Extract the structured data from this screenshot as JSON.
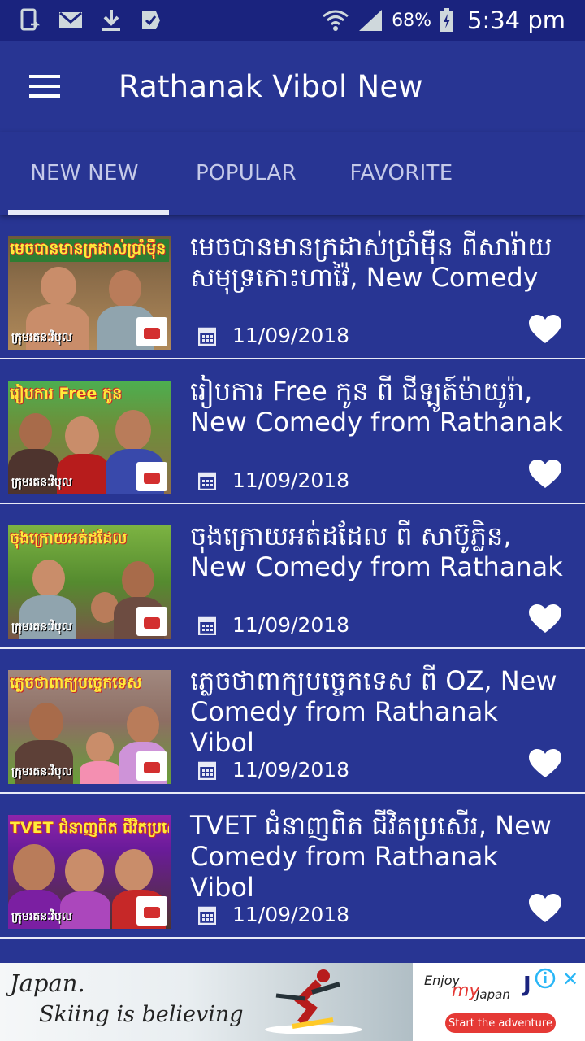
{
  "status_bar": {
    "battery_pct": "68%",
    "time": "5:34 pm",
    "icons": [
      "screenshot-icon",
      "mail-icon",
      "download-icon",
      "task-icon",
      "wifi-icon",
      "signal-icon",
      "battery-charging-icon"
    ]
  },
  "app_bar": {
    "title": "Rathanak Vibol New",
    "menu_icon": "hamburger-menu-icon"
  },
  "tabs": [
    {
      "label": "NEW NEW",
      "selected": true
    },
    {
      "label": "POPULAR",
      "selected": false
    },
    {
      "label": "FAVORITE",
      "selected": false
    }
  ],
  "videos": [
    {
      "title": "មេចបានមានក្រដាស់ប្រាំម៉ឺន ពីសារ៉ាយសមុទ្រកោះហាវ៉ៃ, New Comedy",
      "date": "11/09/2018",
      "thumb_caption": "មេចបានមានក្រដាស់ប្រាំម៉ឺន"
    },
    {
      "title": "រៀបការ Free កូន ពី ជីឡូត៍ម៉ាយូរ៉ា, New Comedy from Rathanak",
      "date": "11/09/2018",
      "thumb_caption": "រៀបការ Free កូន"
    },
    {
      "title": "ចុងក្រោយអត់ដដែល ពី សាប៊ូភ្លិន, New Comedy from Rathanak",
      "date": "11/09/2018",
      "thumb_caption": "ចុងក្រោយអត់ដដែល"
    },
    {
      "title": "ភ្លេចថាពាក្យបច្ចេកទេស ពី OZ, New Comedy from Rathanak Vibol",
      "date": "11/09/2018",
      "thumb_caption": "ភ្លេចថាពាក្យបច្ចេកទេស"
    },
    {
      "title": "TVET ជំនាញពិត ជីវិតប្រសើរ, New Comedy from Rathanak Vibol",
      "date": "11/09/2018",
      "thumb_caption": "TVET ជំនាញពិត ជីវិតប្រសើរ"
    }
  ],
  "thumb_footer": "ក្រុមរតនៈវិបុល",
  "ad": {
    "line1": "Japan.",
    "line2": "Skiing is believing",
    "enjoy": "Enjoy",
    "my": "my",
    "japan": "Japan",
    "brand": "J",
    "cta": "Start the adventure",
    "close": "✕"
  },
  "colors": {
    "primary": "#283593",
    "status_bar": "#1a237e",
    "heart": "#ffffff"
  }
}
